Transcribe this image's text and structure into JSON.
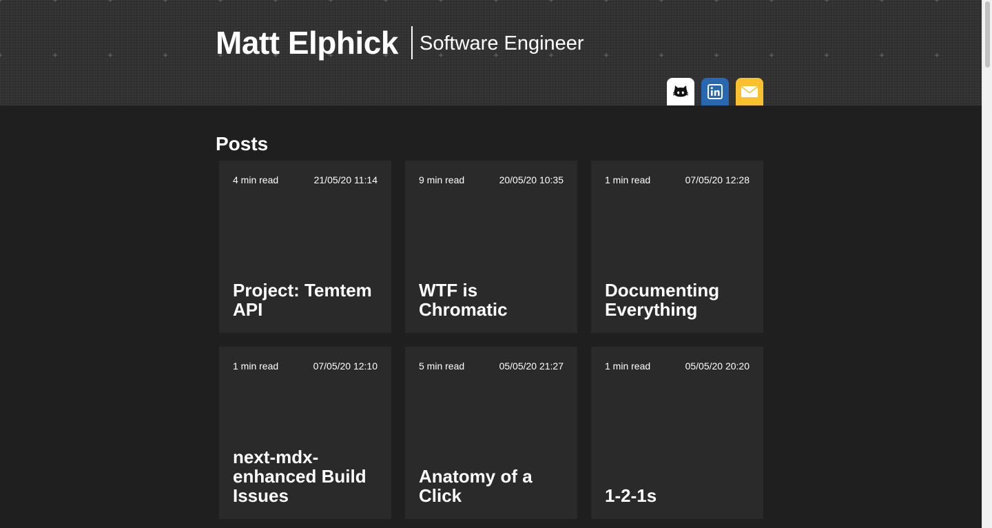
{
  "header": {
    "name": "Matt Elphick",
    "role": "Software Engineer"
  },
  "social_links": [
    {
      "network": "GitHub",
      "icon": "github-icon",
      "color": "#ffffff"
    },
    {
      "network": "LinkedIn",
      "icon": "linkedin-icon",
      "color": "#2867b2"
    },
    {
      "network": "Email",
      "icon": "envelope-icon",
      "color": "#fbc02d"
    }
  ],
  "posts": {
    "heading": "Posts",
    "items": [
      {
        "read_time": "4 min read",
        "date": "21/05/20 11:14",
        "title": "Project: Temtem API"
      },
      {
        "read_time": "9 min read",
        "date": "20/05/20 10:35",
        "title": "WTF is Chromatic"
      },
      {
        "read_time": "1 min read",
        "date": "07/05/20 12:28",
        "title": "Documenting Everything"
      },
      {
        "read_time": "1 min read",
        "date": "07/05/20 12:10",
        "title": "next-mdx-enhanced Build Issues"
      },
      {
        "read_time": "5 min read",
        "date": "05/05/20 21:27",
        "title": "Anatomy of a Click"
      },
      {
        "read_time": "1 min read",
        "date": "05/05/20 20:20",
        "title": "1-2-1s"
      }
    ]
  },
  "colors": {
    "page_background": "#1f1f1f",
    "header_background": "#2f2f2f",
    "card_background": "#2a2a2a",
    "text": "#ffffff"
  }
}
